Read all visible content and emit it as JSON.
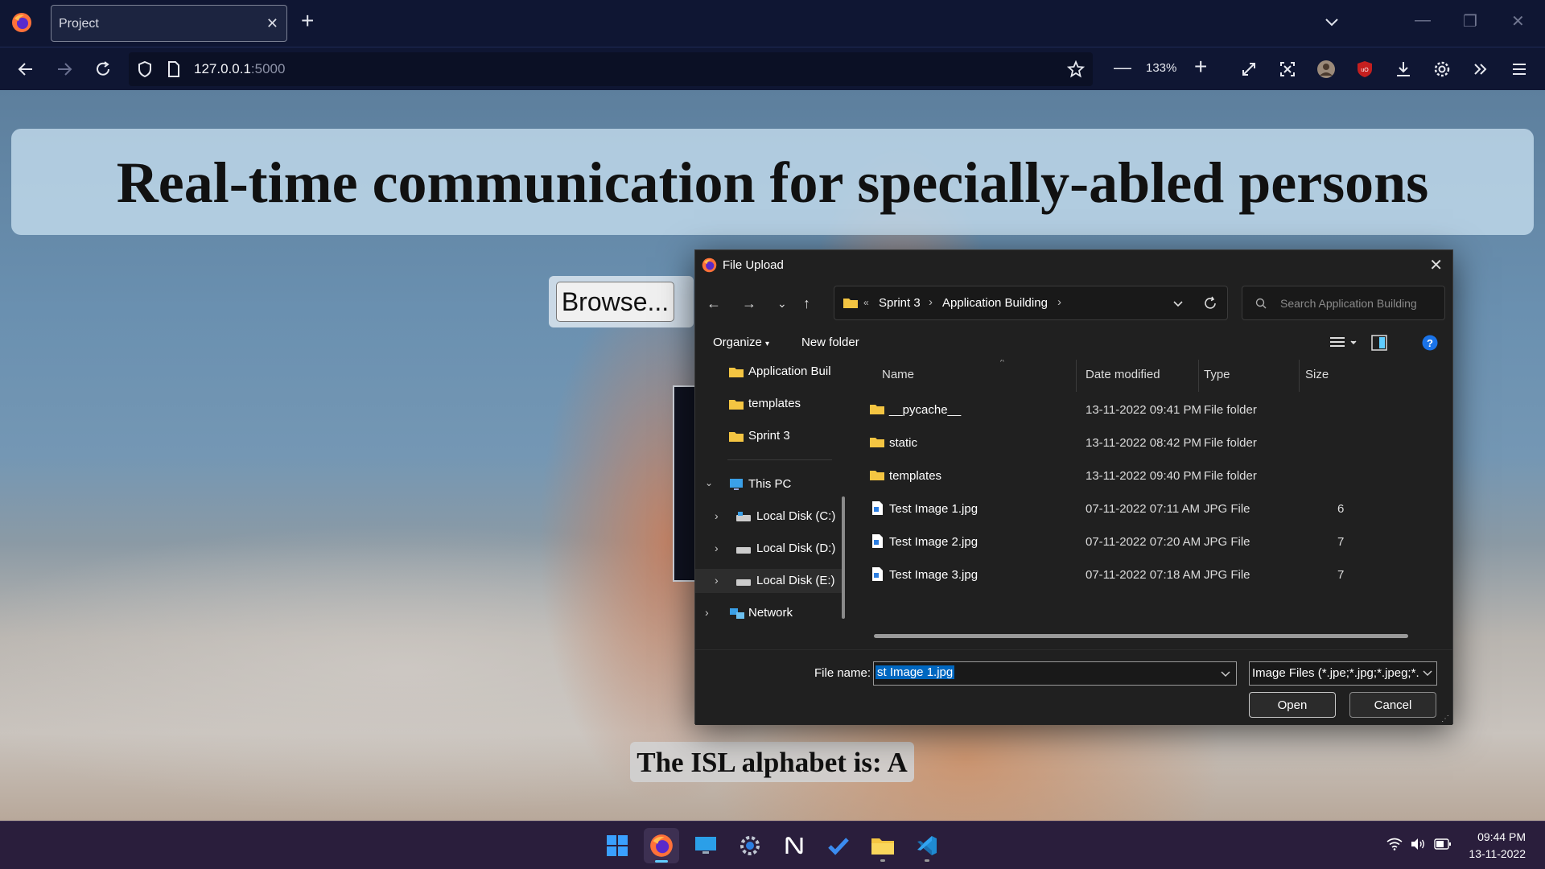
{
  "browser": {
    "tab_title": "Project",
    "url_host": "127.0.0.1",
    "url_port": ":5000",
    "zoom": "133%"
  },
  "page": {
    "title": "Real-time communication for specially-abled persons",
    "browse_label": "Browse...",
    "result_text": "The ISL alphabet is: A"
  },
  "dialog": {
    "title": "File Upload",
    "breadcrumb": [
      "Sprint 3",
      "Application Building"
    ],
    "search_placeholder": "Search Application Building",
    "toolbar": {
      "organize": "Organize",
      "new_folder": "New folder"
    },
    "tree": [
      {
        "label": "Application Buil",
        "icon": "folder-icon"
      },
      {
        "label": "templates",
        "icon": "folder-icon"
      },
      {
        "label": "Sprint 3",
        "icon": "folder-icon"
      },
      {
        "label": "This PC",
        "icon": "computer-icon"
      },
      {
        "label": "Local Disk (C:)",
        "icon": "drive-icon"
      },
      {
        "label": "Local Disk (D:)",
        "icon": "drive-icon"
      },
      {
        "label": "Local Disk (E:)",
        "icon": "drive-icon"
      },
      {
        "label": "Network",
        "icon": "network-icon"
      }
    ],
    "columns": {
      "name": "Name",
      "date": "Date modified",
      "type": "Type",
      "size": "Size"
    },
    "files": [
      {
        "name": "__pycache__",
        "date": "13-11-2022 09:41 PM",
        "type": "File folder",
        "size": ""
      },
      {
        "name": "static",
        "date": "13-11-2022 08:42 PM",
        "type": "File folder",
        "size": ""
      },
      {
        "name": "templates",
        "date": "13-11-2022 09:40 PM",
        "type": "File folder",
        "size": ""
      },
      {
        "name": "Test Image 1.jpg",
        "date": "07-11-2022 07:11 AM",
        "type": "JPG File",
        "size": "6"
      },
      {
        "name": "Test Image 2.jpg",
        "date": "07-11-2022 07:20 AM",
        "type": "JPG File",
        "size": "7"
      },
      {
        "name": "Test Image 3.jpg",
        "date": "07-11-2022 07:18 AM",
        "type": "JPG File",
        "size": "7"
      }
    ],
    "file_name_label": "File name:",
    "file_name_value": "st Image 1.jpg",
    "file_type_value": "Image Files (*.jpe;*.jpg;*.jpeg;*.g",
    "open_label": "Open",
    "cancel_label": "Cancel"
  },
  "taskbar": {
    "time": "09:44 PM",
    "date": "13-11-2022"
  }
}
